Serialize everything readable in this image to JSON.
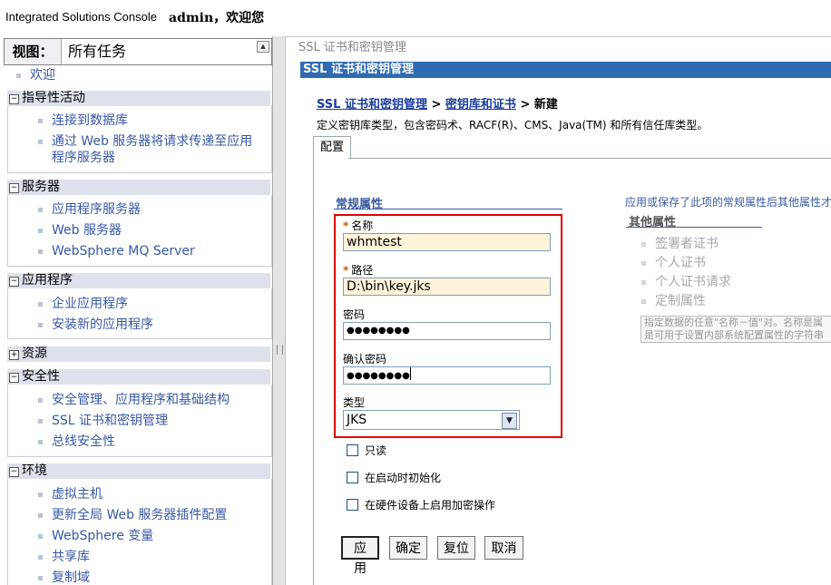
{
  "header": {
    "brand": "Integrated Solutions Console",
    "welcome": "admin，欢迎您"
  },
  "nav": {
    "view_label": "视图：",
    "view_value": "所有任务",
    "welcome_link": "欢迎",
    "sections": [
      {
        "label": "指导性活动",
        "expanded": true,
        "items": [
          "连接到数据库",
          "通过 Web 服务器将请求传递至应用程序服务器"
        ]
      },
      {
        "label": "服务器",
        "expanded": true,
        "items": [
          "应用程序服务器",
          "Web 服务器",
          "WebSphere MQ Server"
        ]
      },
      {
        "label": "应用程序",
        "expanded": true,
        "items": [
          "企业应用程序",
          "安装新的应用程序"
        ]
      },
      {
        "label": "资源",
        "expanded": false,
        "items": []
      },
      {
        "label": "安全性",
        "expanded": true,
        "items": [
          "安全管理、应用程序和基础结构",
          "SSL 证书和密钥管理",
          "总线安全性"
        ]
      },
      {
        "label": "环境",
        "expanded": true,
        "items": [
          "虚拟主机",
          "更新全局 Web 服务器插件配置",
          "WebSphere 变量",
          "共享库",
          "复制域"
        ]
      }
    ]
  },
  "main": {
    "crumb_top": "SSL 证书和密钥管理",
    "title": "SSL 证书和密钥管理",
    "breadcrumb": {
      "link1": "SSL 证书和密钥管理",
      "sep": ">",
      "link2": "密钥库和证书",
      "current": "新建"
    },
    "description": "定义密钥库类型，包含密码术、RACF(R)、CMS、Java(TM) 和所有信任库类型。",
    "tab": "配置",
    "general_title": "常规属性",
    "other_note": "应用或保存了此项的常规属性后其他属性才",
    "other_title": "其他属性",
    "other_items": [
      "签署者证书",
      "个人证书",
      "个人证书请求",
      "定制属性"
    ],
    "tooltip_line1": "指定数据的任意\"名称－值\"对。名称是属",
    "tooltip_line2": "是可用于设置内部系统配置属性的字符串",
    "fields": {
      "required_mark": "*",
      "name_label": "名称",
      "name_value": "whmtest",
      "path_label": "路径",
      "path_value": "D:\\bin\\key.jks",
      "password_label": "密码",
      "password_value": "●●●●●●●●",
      "confirm_label": "确认密码",
      "confirm_value": "●●●●●●●●",
      "type_label": "类型",
      "type_value": "JKS"
    },
    "checkboxes": [
      {
        "label": "只读",
        "checked": false
      },
      {
        "label": "在启动时初始化",
        "checked": false
      },
      {
        "label": "在硬件设备上启用加密操作",
        "checked": false
      }
    ],
    "buttons": {
      "apply": "应用",
      "ok": "确定",
      "reset": "复位",
      "cancel": "取消"
    }
  }
}
